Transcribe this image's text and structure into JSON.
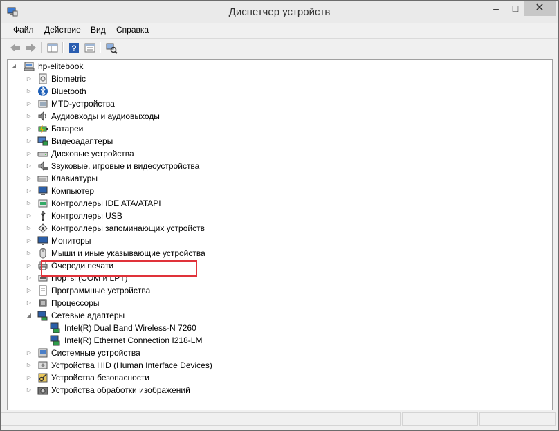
{
  "window": {
    "title": "Диспетчер устройств"
  },
  "menu": [
    "Файл",
    "Действие",
    "Вид",
    "Справка"
  ],
  "tree": {
    "root": "hp-elitebook",
    "items": [
      {
        "label": "Biometric",
        "icon": "biometric-icon"
      },
      {
        "label": "Bluetooth",
        "icon": "bluetooth-icon"
      },
      {
        "label": "MTD-устройства",
        "icon": "mtd-icon"
      },
      {
        "label": "Аудиовходы и аудиовыходы",
        "icon": "speaker-icon"
      },
      {
        "label": "Батареи",
        "icon": "battery-icon"
      },
      {
        "label": "Видеоадаптеры",
        "icon": "display-adapter-icon"
      },
      {
        "label": "Дисковые устройства",
        "icon": "disk-icon"
      },
      {
        "label": "Звуковые, игровые и видеоустройства",
        "icon": "sound-icon"
      },
      {
        "label": "Клавиатуры",
        "icon": "keyboard-icon"
      },
      {
        "label": "Компьютер",
        "icon": "computer-icon"
      },
      {
        "label": "Контроллеры IDE ATA/ATAPI",
        "icon": "ide-icon"
      },
      {
        "label": "Контроллеры USB",
        "icon": "usb-icon"
      },
      {
        "label": "Контроллеры запоминающих устройств",
        "icon": "storage-icon"
      },
      {
        "label": "Мониторы",
        "icon": "monitor-icon"
      },
      {
        "label": "Мыши и иные указывающие устройства",
        "icon": "mouse-icon"
      },
      {
        "label": "Очереди печати",
        "icon": "printer-icon"
      },
      {
        "label": "Порты (COM и LPT)",
        "icon": "port-icon"
      },
      {
        "label": "Программные устройства",
        "icon": "software-device-icon"
      },
      {
        "label": "Процессоры",
        "icon": "processor-icon"
      },
      {
        "label": "Сетевые адаптеры",
        "icon": "network-adapter-icon",
        "expanded": true,
        "children": [
          "Intel(R) Dual Band Wireless-N 7260",
          "Intel(R) Ethernet Connection I218-LM"
        ]
      },
      {
        "label": "Системные устройства",
        "icon": "system-icon"
      },
      {
        "label": "Устройства HID (Human Interface Devices)",
        "icon": "hid-icon"
      },
      {
        "label": "Устройства безопасности",
        "icon": "security-icon"
      },
      {
        "label": "Устройства обработки изображений",
        "icon": "camera-icon"
      }
    ]
  },
  "colors": {
    "highlight_border": "#e0323a"
  }
}
